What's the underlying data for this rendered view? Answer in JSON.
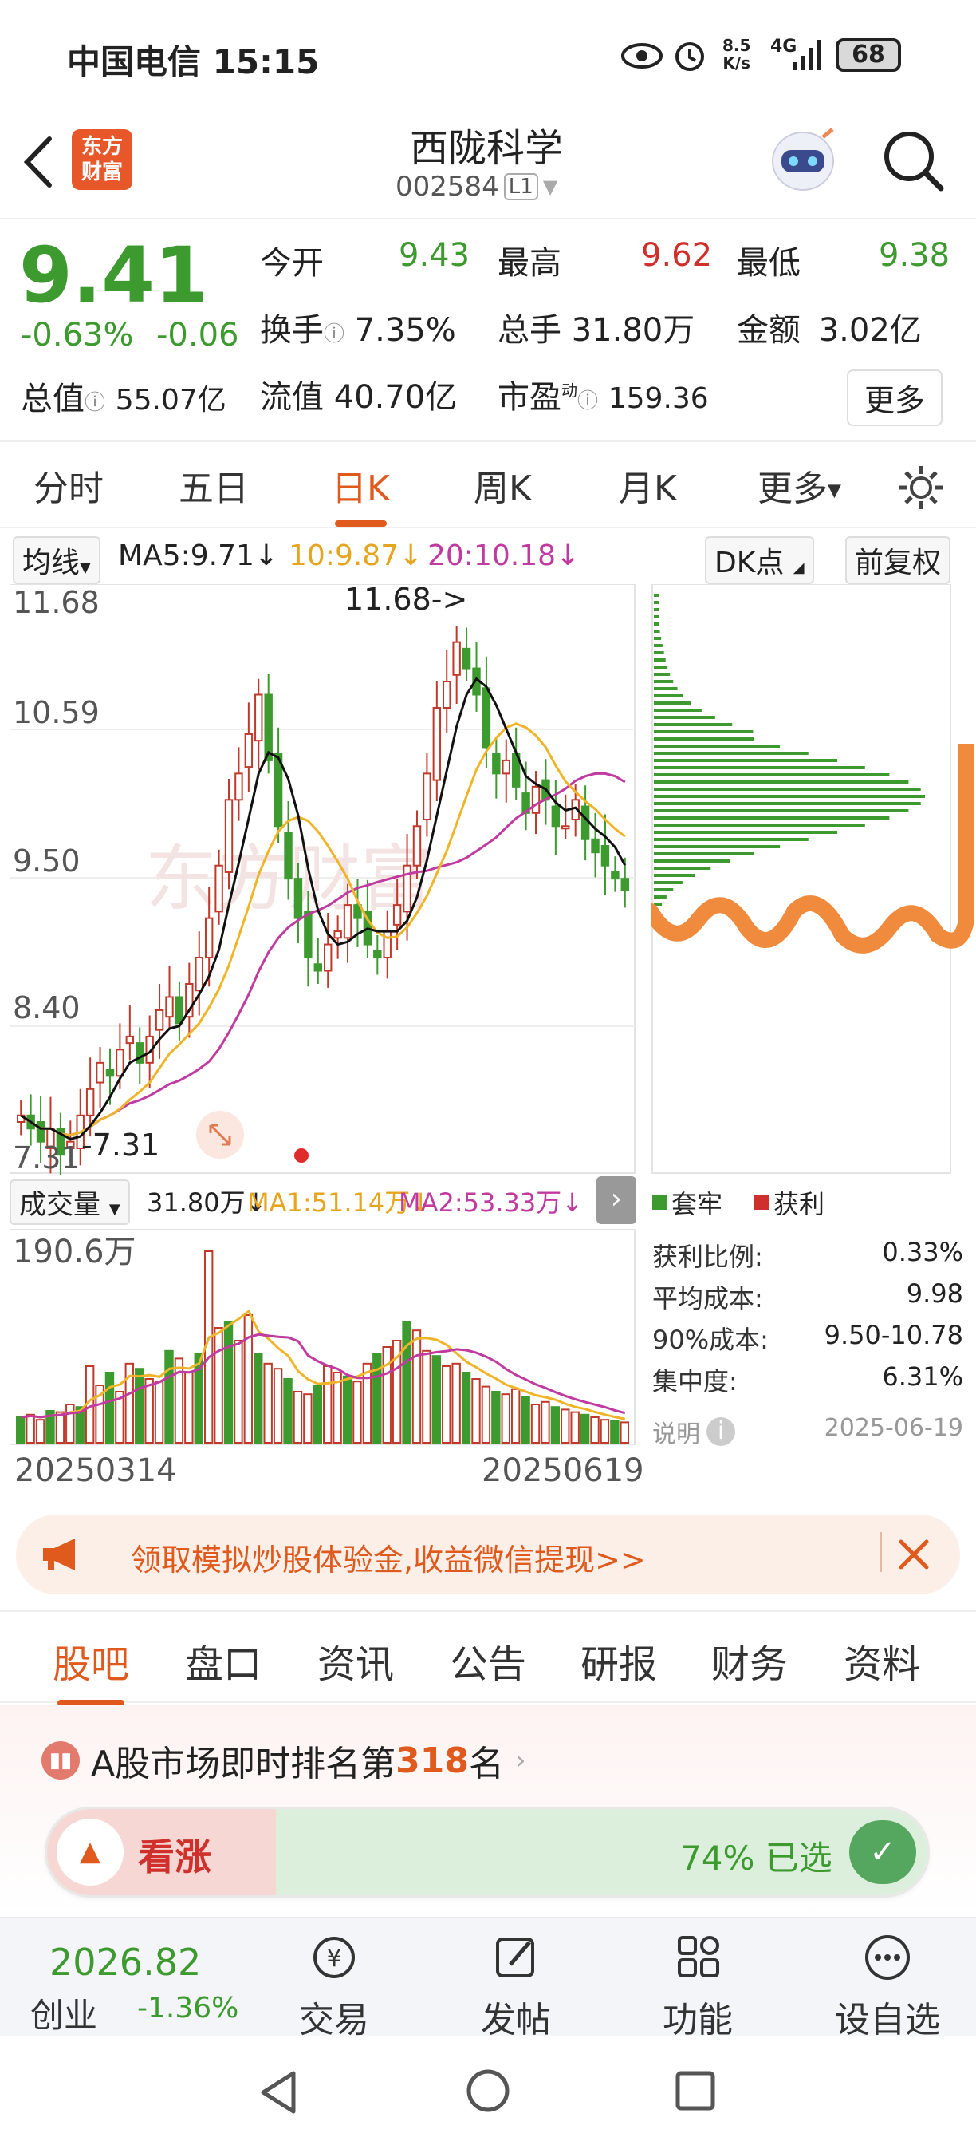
{
  "status": {
    "carrier": "中国电信",
    "time": "15:15",
    "net_speed_top": "8.5",
    "net_speed_unit": "K/s",
    "net_type": "4G",
    "battery": "68"
  },
  "header": {
    "logo_text_top": "东方",
    "logo_text_bottom": "财富",
    "stock_name": "西陇科学",
    "stock_code": "002584",
    "level_badge": "L1"
  },
  "quote": {
    "price": "9.41",
    "change_pct": "-0.63%",
    "change_abs": "-0.06",
    "open_label": "今开",
    "open": "9.43",
    "high_label": "最高",
    "high": "9.62",
    "low_label": "最低",
    "low": "9.38",
    "turnover_label": "换手",
    "turnover": "7.35%",
    "volume_label": "总手",
    "volume": "31.80万",
    "amount_label": "金额",
    "amount": "3.02亿",
    "mcap_label": "总值",
    "mcap": "55.07亿",
    "float_label": "流值",
    "float": "40.70亿",
    "pe_label": "市盈",
    "pe_sup": "动",
    "pe": "159.36",
    "more_button": "更多"
  },
  "tabs": [
    "分时",
    "五日",
    "日K",
    "周K",
    "月K",
    "更多"
  ],
  "active_tab": "日K",
  "chart_toolbar": {
    "ma_selector": "均线",
    "ma5": "MA5:9.71↓",
    "ma10": "10:9.87↓",
    "ma20": "20:10.18↓",
    "dk_button": "DK点",
    "adjust_button": "前复权"
  },
  "kline": {
    "y_labels": [
      "11.68",
      "10.59",
      "9.50",
      "8.40",
      "7.31"
    ],
    "high_marker": "11.68->",
    "low_marker": "-7.31",
    "watermark": "东方财富"
  },
  "volume": {
    "selector": "成交量",
    "total": "31.80万↓",
    "ma1": "MA1:51.14万↓",
    "ma2": "MA2:53.33万↓",
    "y_max": "190.6万",
    "start_date": "20250314",
    "end_date": "20250619"
  },
  "chip_panel": {
    "legend_trapped": "套牢",
    "legend_profit": "获利",
    "rows": [
      {
        "label": "获利比例:",
        "value": "0.33%"
      },
      {
        "label": "平均成本:",
        "value": "9.98"
      },
      {
        "label": "90%成本:",
        "value": "9.50-10.78"
      },
      {
        "label": "集中度:",
        "value": "6.31%"
      }
    ],
    "note_label": "说明",
    "date": "2025-06-19"
  },
  "banner": {
    "text": "领取模拟炒股体验金,收益微信提现>>"
  },
  "subtabs": [
    "股吧",
    "盘口",
    "资讯",
    "公告",
    "研报",
    "财务",
    "资料"
  ],
  "active_subtab": "股吧",
  "ranking": {
    "prefix": "A股市场即时排名第",
    "rank": "318",
    "suffix": "名",
    "bull_label": "看涨",
    "selected_text": "74% 已选",
    "bull_fraction": 0.74
  },
  "bottom_nav": {
    "index_value": "2026.82",
    "index_name": "创业",
    "index_change": "-1.36%",
    "items": [
      "交易",
      "发帖",
      "功能",
      "设自选"
    ]
  },
  "colors": {
    "accent": "#e05a1e",
    "up": "#d0302b",
    "down": "#3d9a2f",
    "ma5": "#111111",
    "ma10": "#f0b429",
    "ma20": "#c03aa0"
  }
}
